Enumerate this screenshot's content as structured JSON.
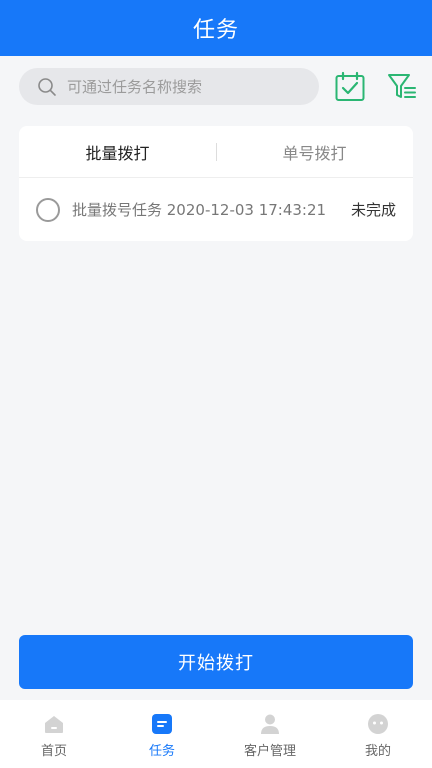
{
  "header": {
    "title": "任务"
  },
  "search": {
    "placeholder": "可通过任务名称搜索",
    "value": ""
  },
  "tabs": [
    {
      "label": "批量拨打",
      "active": true
    },
    {
      "label": "单号拨打",
      "active": false
    }
  ],
  "tasks": [
    {
      "name": "批量拨号任务 2020-12-03 17:43:21",
      "status": "未完成"
    }
  ],
  "actions": {
    "start_label": "开始拨打"
  },
  "bottom_nav": [
    {
      "label": "首页",
      "icon": "home-icon"
    },
    {
      "label": "任务",
      "icon": "task-icon",
      "active": true
    },
    {
      "label": "客户管理",
      "icon": "customer-icon"
    },
    {
      "label": "我的",
      "icon": "profile-icon"
    }
  ],
  "colors": {
    "primary": "#1778f9",
    "accent_green": "#2bb673",
    "background": "#f5f6f8"
  }
}
